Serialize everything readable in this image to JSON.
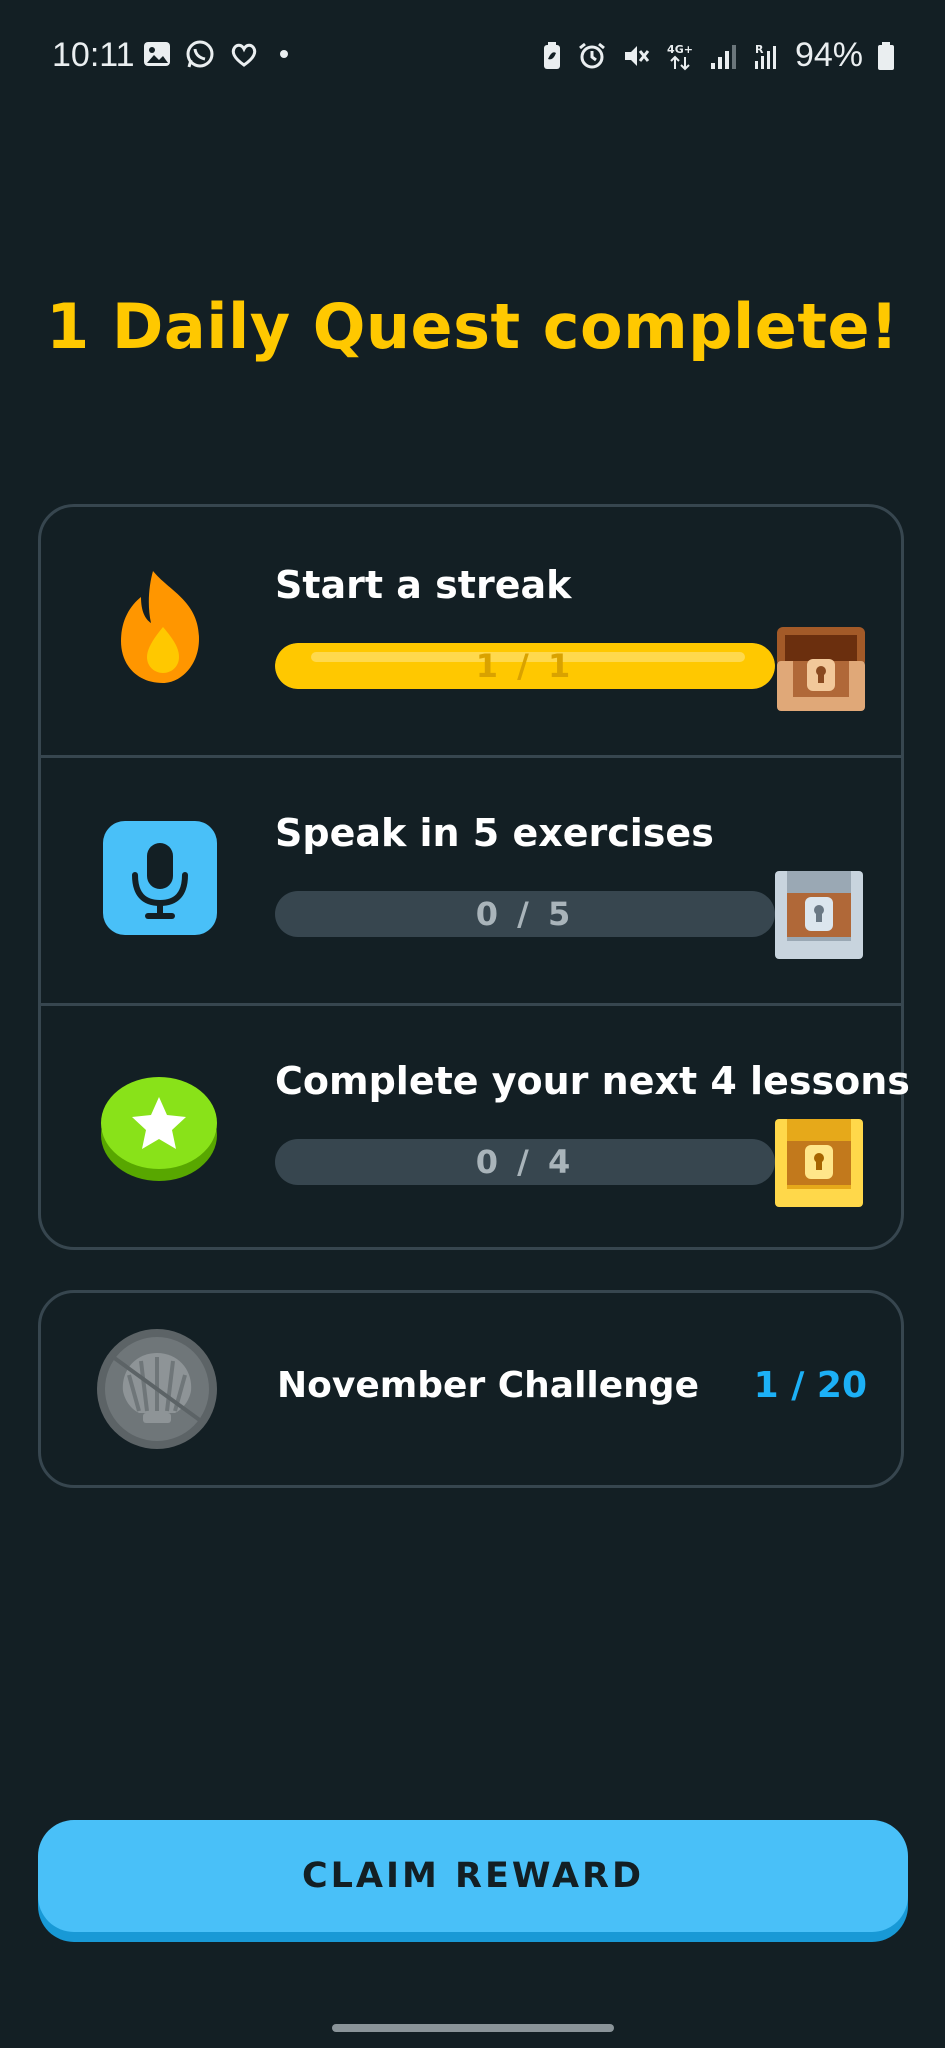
{
  "status_bar": {
    "time": "10:11",
    "left_icons": [
      "gallery-icon",
      "whatsapp-icon",
      "heart-app-icon"
    ],
    "right_icons": [
      "battery-saver-icon",
      "alarm-icon",
      "mute-icon",
      "network-4g-icon",
      "signal-icon",
      "signal-roaming-icon"
    ],
    "network_label": "4G+",
    "roaming_label": "R",
    "battery_percent": "94%"
  },
  "headline": "1 Daily Quest complete!",
  "quests": [
    {
      "title": "Start a streak",
      "progress_text": "1 / 1",
      "current": 1,
      "total": 1,
      "icon": "flame-icon",
      "chest": "open-chest-icon"
    },
    {
      "title": "Speak in 5 exercises",
      "progress_text": "0 / 5",
      "current": 0,
      "total": 5,
      "icon": "microphone-icon",
      "chest": "silver-chest-icon"
    },
    {
      "title": "Complete your next 4 lessons",
      "progress_text": "0 / 4",
      "current": 0,
      "total": 4,
      "icon": "star-icon",
      "chest": "gold-chest-icon"
    }
  ],
  "challenge": {
    "title": "November Challenge",
    "progress_text": "1 / 20",
    "icon": "shell-badge-icon"
  },
  "claim_button_label": "CLAIM REWARD",
  "colors": {
    "background": "#131f24",
    "headline": "#ffc800",
    "card_border": "#37464f",
    "progress_fill": "#ffc800",
    "challenge_progress": "#1cb0f6",
    "button": "#49c0f8"
  }
}
